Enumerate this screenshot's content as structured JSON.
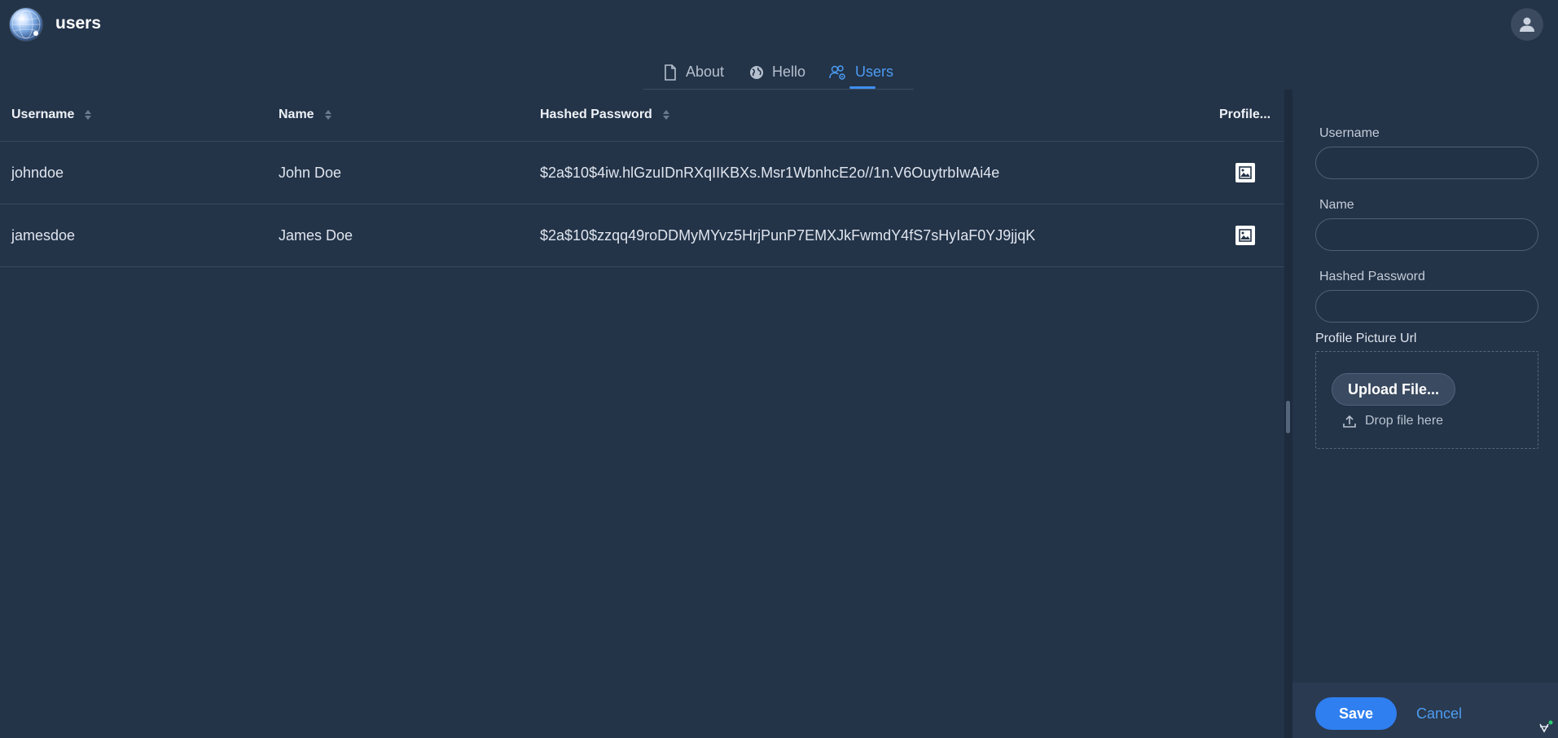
{
  "app": {
    "title": "users"
  },
  "tabs": [
    {
      "label": "About",
      "icon": "document-icon",
      "active": false
    },
    {
      "label": "Hello",
      "icon": "globe-icon",
      "active": false
    },
    {
      "label": "Users",
      "icon": "users-gear-icon",
      "active": true
    }
  ],
  "grid": {
    "columns": [
      "Username",
      "Name",
      "Hashed Password",
      "Profile..."
    ],
    "rows": [
      {
        "username": "johndoe",
        "name": "John Doe",
        "hashed_password": "$2a$10$4iw.hlGzuIDnRXqIIKBXs.Msr1WbnhcE2o//1n.V6OuytrbIwAi4e",
        "profile_icon": "image-icon"
      },
      {
        "username": "jamesdoe",
        "name": "James Doe",
        "hashed_password": "$2a$10$zzqq49roDDMyMYvz5HrjPunP7EMXJkFwmdY4fS7sHyIaF0YJ9jjqK",
        "profile_icon": "image-icon"
      }
    ]
  },
  "form": {
    "username_label": "Username",
    "username_value": "",
    "name_label": "Name",
    "name_value": "",
    "password_label": "Hashed Password",
    "password_value": "",
    "picture_label": "Profile Picture Url",
    "upload_button": "Upload File...",
    "drop_hint": "Drop file here",
    "save": "Save",
    "cancel": "Cancel"
  },
  "colors": {
    "background": "#233348",
    "accent": "#4c9cf2",
    "primary_button": "#2f7ff0"
  }
}
